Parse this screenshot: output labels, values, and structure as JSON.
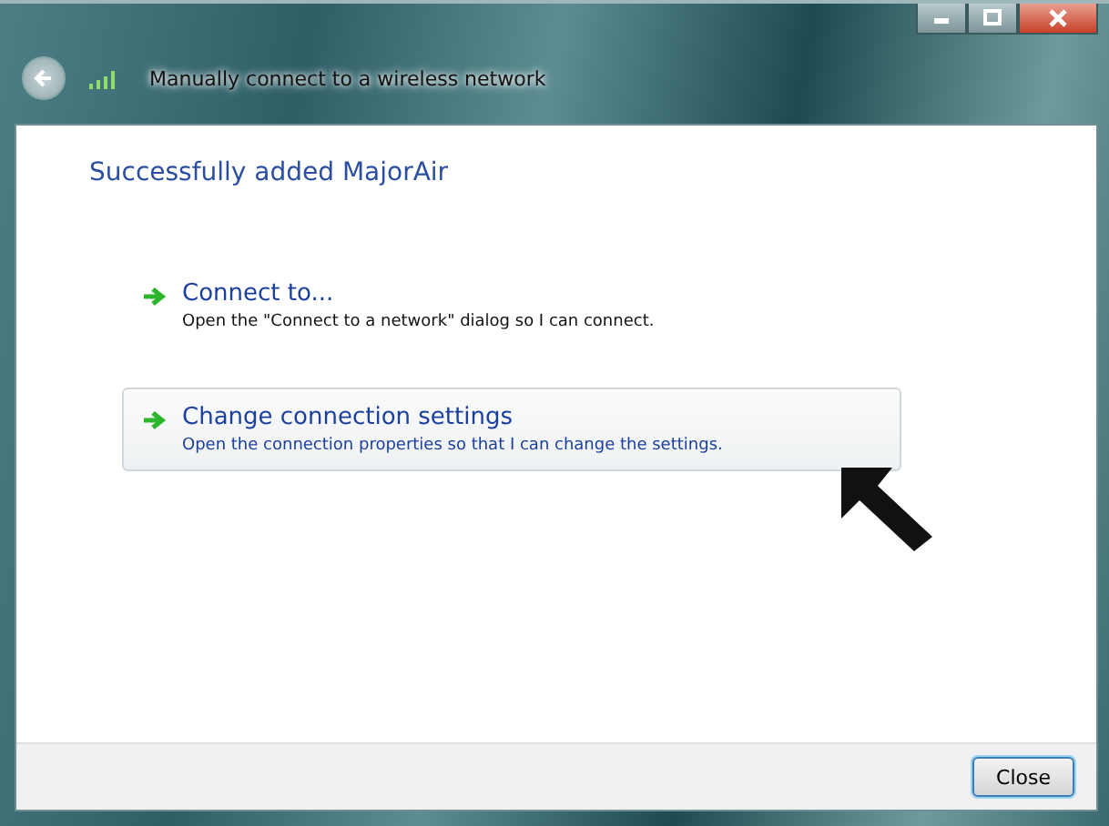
{
  "window": {
    "title": "Manually connect to a wireless network"
  },
  "heading": "Successfully added MajorAir",
  "options": [
    {
      "label": "Connect to...",
      "description": "Open the \"Connect to a network\" dialog so I can connect.",
      "selected": false
    },
    {
      "label": "Change connection settings",
      "description": "Open the connection properties so that I can change the settings.",
      "selected": true
    }
  ],
  "buttons": [
    "Close"
  ]
}
